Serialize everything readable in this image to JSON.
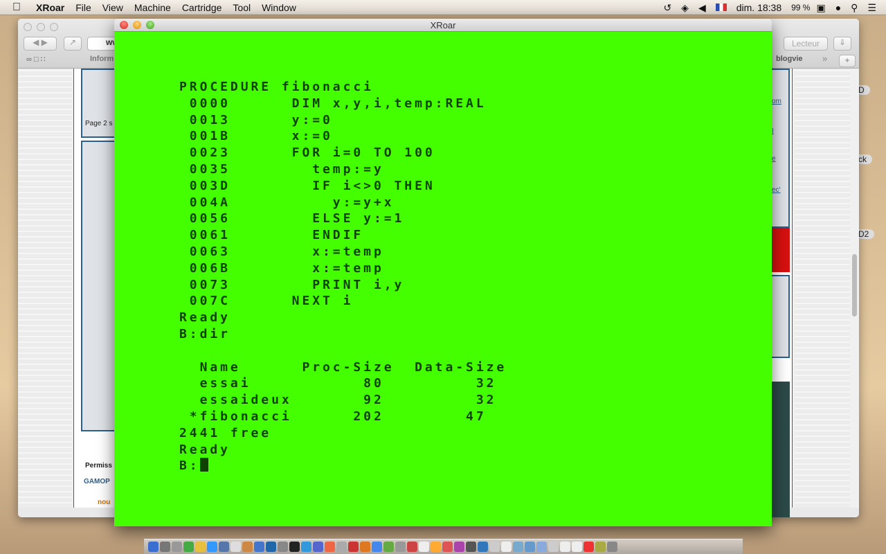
{
  "menubar": {
    "app": "XRoar",
    "items": [
      "File",
      "View",
      "Machine",
      "Cartridge",
      "Tool",
      "Window"
    ],
    "status": {
      "keyboard": "FR",
      "clock": "dim. 18:38",
      "battery": "99 %"
    }
  },
  "safari": {
    "address_partial": "ww",
    "reader": "Lecteur",
    "bookmark_partial": "Inform",
    "bookmark_right": "blogvie",
    "page_text": "Page 2 s",
    "perm_text": "Permiss",
    "gamo_text": "GAMOP",
    "new_text": "nou",
    "right_links": [
      "om",
      "I",
      "e",
      "ec'"
    ]
  },
  "desktop": {
    "volumes": [
      "D",
      "ck",
      "D2"
    ]
  },
  "xroar": {
    "title": "XRoar",
    "bg_color": "#44ff00",
    "fg_color": "#0f4200",
    "terminal": {
      "lines": [
        "PROCEDURE fibonacci",
        " 0000      DIM x,y,i,temp:REAL",
        " 0013      y:=0",
        " 001B      x:=0",
        " 0023      FOR i=0 TO 100",
        " 0035        temp:=y",
        " 003D        IF i<>0 THEN",
        " 004A          y:=y+x",
        " 0056        ELSE y:=1",
        " 0061        ENDIF",
        " 0063        x:=temp",
        " 006B        x:=temp",
        " 0073        PRINT i,y",
        " 007C      NEXT i",
        "Ready",
        "B:dir",
        "",
        "  Name      Proc-Size  Data-Size",
        "  essai           80         32",
        "  essaideux       92         32",
        " *fibonacci      202        47",
        "2441 free",
        "Ready"
      ],
      "prompt": "B:"
    }
  }
}
